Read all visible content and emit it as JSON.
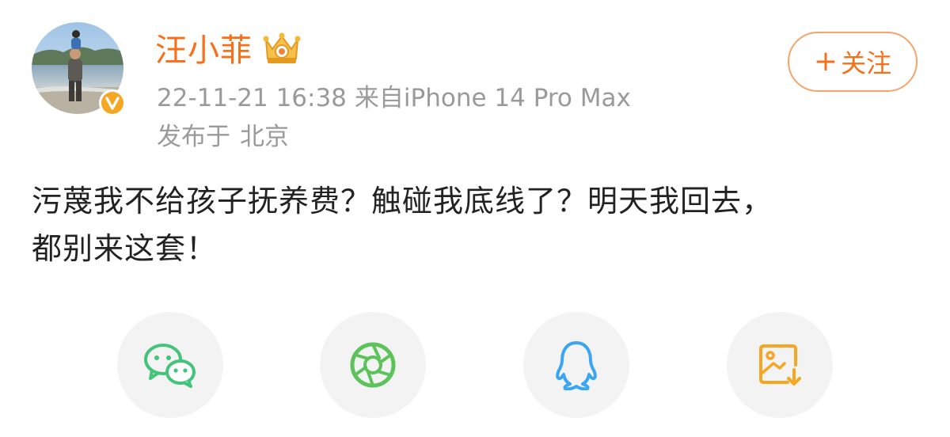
{
  "user": {
    "name": "汪小菲",
    "avatar_icon": "avatar-photo",
    "verified_icon": "verified-v-icon",
    "vip_icon": "crown-vip-icon"
  },
  "meta": {
    "timestamp": "22-11-21 16:38",
    "source": "来自iPhone 14 Pro Max",
    "location_prefix": "发布于",
    "location": "北京"
  },
  "follow": {
    "plus": "+",
    "label": "关注"
  },
  "post": {
    "line1": "污蔑我不给孩子抚养费？触碰我底线了？明天我回去，",
    "line2": "都别来这套！"
  },
  "share": [
    {
      "name": "wechat",
      "icon": "wechat-icon",
      "color": "#43c47a"
    },
    {
      "name": "moments",
      "icon": "wechat-moments-icon",
      "color": "#5cc35b"
    },
    {
      "name": "qq",
      "icon": "qq-icon",
      "color": "#3aa5f0"
    },
    {
      "name": "save-image",
      "icon": "save-image-icon",
      "color": "#f5a623"
    }
  ],
  "colors": {
    "accent": "#f86f1a",
    "meta_gray": "#9a9a9a",
    "text": "#222222",
    "share_bg": "#f3f3f3",
    "verified": "#f5a623"
  }
}
